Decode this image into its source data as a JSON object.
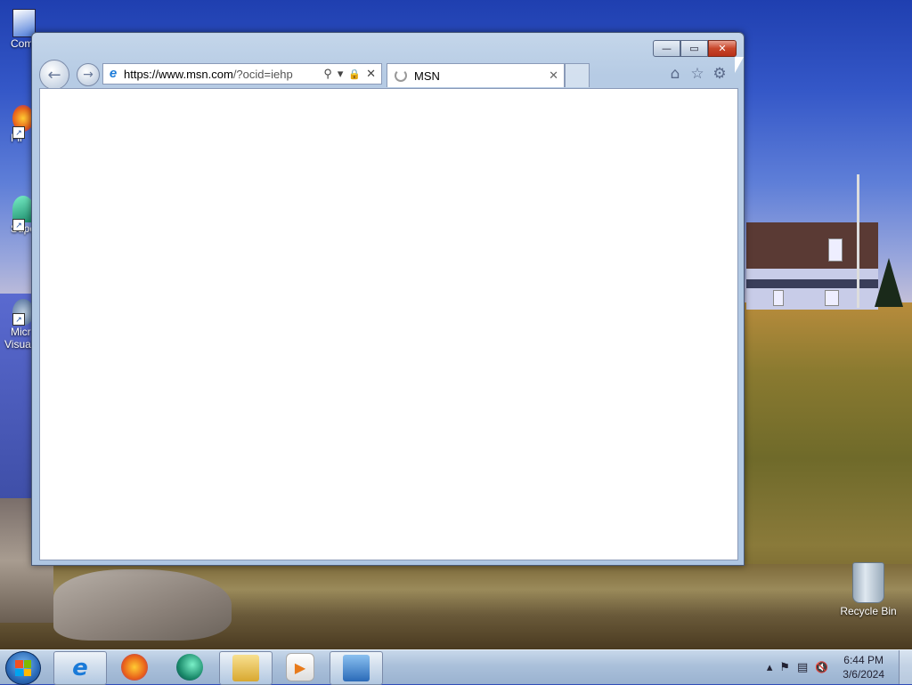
{
  "desktop": {
    "left_icons": [
      {
        "label": "Com",
        "icon": "computer-icon"
      },
      {
        "label": "Fir",
        "icon": "firefox-icon"
      },
      {
        "label": "Supe",
        "icon": "app-icon"
      },
      {
        "label": "Micr",
        "label2": "Visual",
        "icon": "visual-studio-icon"
      }
    ],
    "recycle_bin": {
      "label": "Recycle Bin",
      "icon": "recycle-bin-icon"
    }
  },
  "browser": {
    "title_buttons": {
      "minimize": "—",
      "maximize": "▭",
      "close": "✕"
    },
    "address": {
      "url_prefix": "https://www.",
      "url_host": "msn.com",
      "url_rest": "/?ocid=iehp",
      "search_glyph": "⚲",
      "dropdown_glyph": "▾",
      "lock_glyph": "🔒",
      "stop_glyph": "✕"
    },
    "tab": {
      "title": "MSN",
      "close": "✕"
    },
    "nav": {
      "back": "←",
      "forward": "→"
    },
    "toolbar": {
      "home": "⌂",
      "favorites": "☆",
      "tools": "⚙"
    }
  },
  "taskbar": {
    "items": [
      {
        "name": "internet-explorer",
        "glyph": "e",
        "color": "#1a7ad8",
        "active": true
      },
      {
        "name": "firefox",
        "glyph": "",
        "color": "#e8601a"
      },
      {
        "name": "app-green",
        "glyph": "",
        "color": "#1a8a6a"
      },
      {
        "name": "file-explorer",
        "glyph": "",
        "color": "#e8c050"
      },
      {
        "name": "media-player",
        "glyph": "▶",
        "color": "#e87a1a"
      },
      {
        "name": "control-panel",
        "glyph": "",
        "color": "#3a7ac8"
      }
    ],
    "tray": {
      "show_hidden": "▴",
      "flag": "⚑",
      "network": "▤",
      "volume": "🔇"
    },
    "clock": {
      "time": "6:44 PM",
      "date": "3/6/2024"
    }
  },
  "colors": {
    "accent": "#1a7ad8",
    "close_button": "#c8462a"
  }
}
